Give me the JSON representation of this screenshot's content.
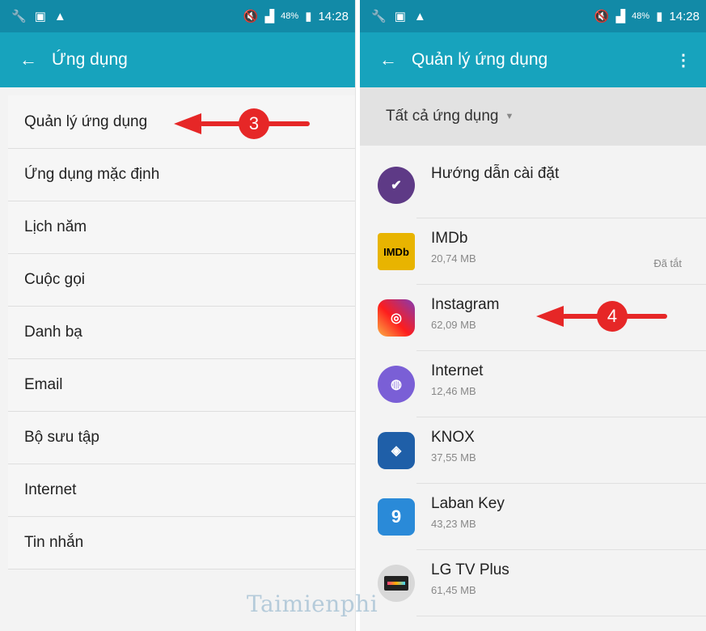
{
  "left": {
    "status": {
      "battery": "48%",
      "time": "14:28"
    },
    "appbar": {
      "back_label": "←",
      "title": "Ứng dụng"
    },
    "items": [
      {
        "label": "Quản lý ứng dụng"
      },
      {
        "label": "Ứng dụng mặc định"
      },
      {
        "label": "Lịch năm"
      },
      {
        "label": "Cuộc gọi"
      },
      {
        "label": "Danh bạ"
      },
      {
        "label": "Email"
      },
      {
        "label": "Bộ sưu tập"
      },
      {
        "label": "Internet"
      },
      {
        "label": "Tin nhắn"
      }
    ],
    "annotation": "3"
  },
  "right": {
    "status": {
      "battery": "48%",
      "time": "14:28"
    },
    "appbar": {
      "back_label": "←",
      "title": "Quản lý ứng dụng",
      "menu_label": "⋮"
    },
    "filter": {
      "label": "Tất cả ứng dụng"
    },
    "apps": [
      {
        "name": "Hướng dẫn cài đặt",
        "size": "",
        "status": "",
        "icon": "guide-icon"
      },
      {
        "name": "IMDb",
        "size": "20,74 MB",
        "status": "Đã tắt",
        "icon": "imdb-icon",
        "icon_text": "IMDb"
      },
      {
        "name": "Instagram",
        "size": "62,09 MB",
        "status": "",
        "icon": "instagram-icon"
      },
      {
        "name": "Internet",
        "size": "12,46 MB",
        "status": "",
        "icon": "internet-icon"
      },
      {
        "name": "KNOX",
        "size": "37,55 MB",
        "status": "",
        "icon": "knox-icon"
      },
      {
        "name": "Laban Key",
        "size": "43,23 MB",
        "status": "",
        "icon": "laban-key-icon",
        "icon_text": "9"
      },
      {
        "name": "LG TV Plus",
        "size": "61,45 MB",
        "status": "",
        "icon": "lg-tv-plus-icon"
      }
    ],
    "annotation": "4"
  },
  "watermark": "Taimienphi",
  "colors": {
    "statusbar": "#128aa7",
    "appbar": "#17a3bd",
    "annotation_red": "#e62727"
  }
}
